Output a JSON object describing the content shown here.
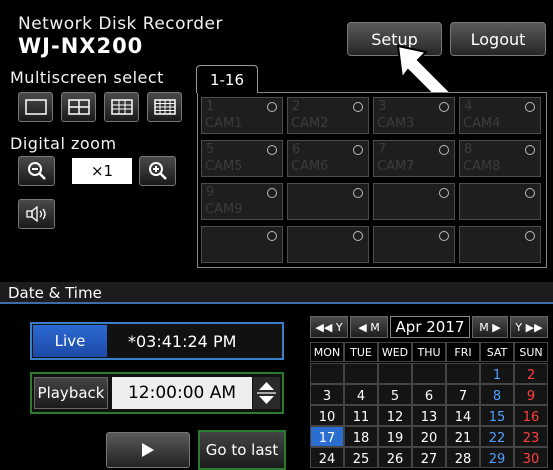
{
  "header": {
    "title": "Network Disk Recorder",
    "model": "WJ-NX200",
    "setup_label": "Setup",
    "logout_label": "Logout"
  },
  "multiscreen": {
    "label": "Multiscreen select",
    "buttons": [
      "1-screen",
      "4-screen",
      "9-screen",
      "16-screen"
    ]
  },
  "zoom": {
    "label": "Digital zoom",
    "value": "×1"
  },
  "camera_tab": "1-16",
  "cameras": [
    {
      "num": "1",
      "name": "CAM1"
    },
    {
      "num": "2",
      "name": "CAM2"
    },
    {
      "num": "3",
      "name": "CAM3"
    },
    {
      "num": "4",
      "name": "CAM4"
    },
    {
      "num": "5",
      "name": "CAM5"
    },
    {
      "num": "6",
      "name": "CAM6"
    },
    {
      "num": "7",
      "name": "CAM7"
    },
    {
      "num": "8",
      "name": "CAM8"
    },
    {
      "num": "9",
      "name": "CAM9"
    },
    {
      "num": "",
      "name": ""
    },
    {
      "num": "",
      "name": ""
    },
    {
      "num": "",
      "name": ""
    },
    {
      "num": "",
      "name": ""
    },
    {
      "num": "",
      "name": ""
    },
    {
      "num": "",
      "name": ""
    },
    {
      "num": "",
      "name": ""
    }
  ],
  "datetime": {
    "label": "Date & Time",
    "live_label": "Live",
    "live_time": "*03:41:24 PM",
    "playback_label": "Playback",
    "playback_time": "12:00:00 AM",
    "go_to_last_label": "Go to last"
  },
  "calendar": {
    "month": "Apr 2017",
    "nav": {
      "prev_year": "◀◀ Y",
      "prev_month": "◀ M",
      "next_month": "M ▶",
      "next_year": "Y ▶▶"
    },
    "days_of_week": [
      "MON",
      "TUE",
      "WED",
      "THU",
      "FRI",
      "SAT",
      "SUN"
    ],
    "rows": [
      [
        "",
        "",
        "",
        "",
        "",
        "1",
        "2"
      ],
      [
        "3",
        "4",
        "5",
        "6",
        "7",
        "8",
        "9"
      ],
      [
        "10",
        "11",
        "12",
        "13",
        "14",
        "15",
        "16"
      ],
      [
        "17",
        "18",
        "19",
        "20",
        "21",
        "22",
        "23"
      ],
      [
        "24",
        "25",
        "26",
        "27",
        "28",
        "29",
        "30"
      ]
    ],
    "selected_day": "17",
    "colors": {
      "saturday": "#4fa0ff",
      "sunday": "#ff4040",
      "selected_bg": "#2a6fd0"
    }
  },
  "colors": {
    "live_accent": "#2c6ad0",
    "playback_accent": "#2b7a30"
  }
}
